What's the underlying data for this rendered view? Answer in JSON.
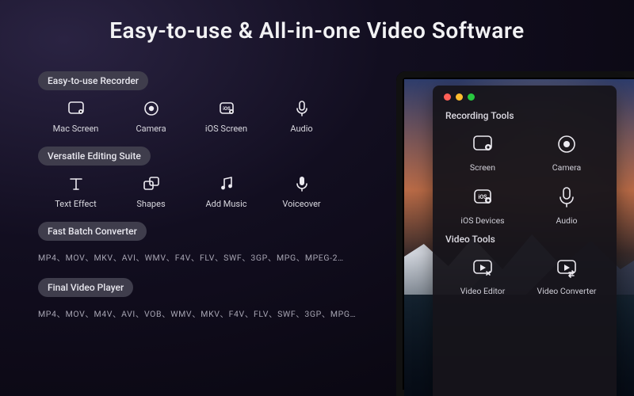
{
  "headline": "Easy-to-use & All-in-one Video Software",
  "sections": {
    "recorder": {
      "title": "Easy-to-use Recorder",
      "items": [
        {
          "label": "Mac Screen"
        },
        {
          "label": "Camera"
        },
        {
          "label": "iOS Screen"
        },
        {
          "label": "Audio"
        }
      ]
    },
    "editing": {
      "title": "Versatile Editing Suite",
      "items": [
        {
          "label": "Text Effect"
        },
        {
          "label": "Shapes"
        },
        {
          "label": "Add Music"
        },
        {
          "label": "Voiceover"
        }
      ]
    },
    "converter": {
      "title": "Fast Batch Converter",
      "formats": "MP4、MOV、MKV、AVI、WMV、F4V、FLV、SWF、3GP、MPG、MPEG-2…"
    },
    "player": {
      "title": "Final Video Player",
      "formats": "MP4、MOV、M4V、AVI、VOB、WMV、MKV、F4V、FLV、SWF、3GP、MPG…"
    }
  },
  "app_panel": {
    "recording_title": "Recording Tools",
    "video_title": "Video Tools",
    "recording_tools": [
      {
        "label": "Screen"
      },
      {
        "label": "Camera"
      },
      {
        "label": "iOS Devices"
      },
      {
        "label": "Audio"
      }
    ],
    "video_tools": [
      {
        "label": "Video Editor"
      },
      {
        "label": "Video Converter"
      }
    ]
  }
}
